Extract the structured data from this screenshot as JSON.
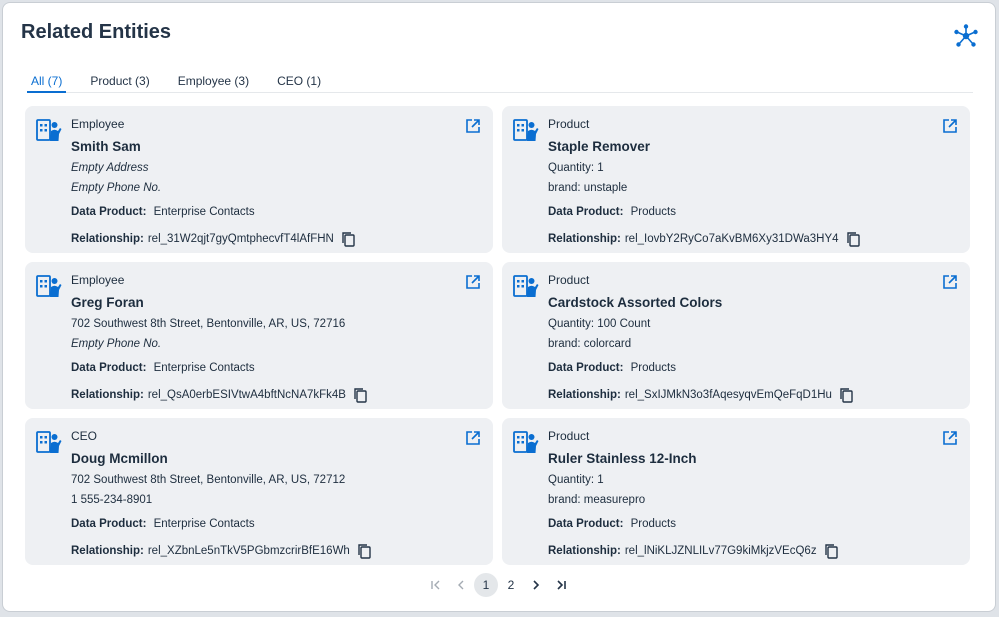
{
  "header": {
    "title": "Related Entities",
    "graph_icon": "network-graph-icon"
  },
  "tabs": [
    {
      "label": "All (7)",
      "active": true
    },
    {
      "label": "Product (3)",
      "active": false
    },
    {
      "label": "Employee (3)",
      "active": false
    },
    {
      "label": "CEO (1)",
      "active": false
    }
  ],
  "labels": {
    "data_product": "Data Product:",
    "relationship": "Relationship:"
  },
  "cards": [
    {
      "type": "Employee",
      "name": "Smith Sam",
      "line1": "Empty Address",
      "line2": "Empty Phone No.",
      "data_product": "Enterprise Contacts",
      "relationship": "rel_31W2qjt7gyQmtphecvfT4lAfFHN"
    },
    {
      "type": "Product",
      "name": "Staple Remover",
      "line1": "Quantity: 1",
      "line2": "brand: unstaple",
      "data_product": "Products",
      "relationship": "rel_IovbY2RyCo7aKvBM6Xy31DWa3HY4"
    },
    {
      "type": "Employee",
      "name": "Greg Foran",
      "line1": "702 Southwest 8th Street, Bentonville, AR, US, 72716",
      "line2": "Empty Phone No.",
      "data_product": "Enterprise Contacts",
      "relationship": "rel_QsA0erbESIVtwA4bftNcNA7kFk4B"
    },
    {
      "type": "Product",
      "name": "Cardstock Assorted Colors",
      "line1": "Quantity: 100 Count",
      "line2": "brand: colorcard",
      "data_product": "Products",
      "relationship": "rel_SxIJMkN3o3fAqesyqvEmQeFqD1Hu"
    },
    {
      "type": "CEO",
      "name": "Doug Mcmillon",
      "line1": "702 Southwest 8th Street, Bentonville, AR, US, 72712",
      "line2": "1 555-234-8901",
      "data_product": "Enterprise Contacts",
      "relationship": "rel_XZbnLe5nTkV5PGbmzcrirBfE16Wh"
    },
    {
      "type": "Product",
      "name": "Ruler Stainless 12-Inch",
      "line1": "Quantity: 1",
      "line2": "brand: measurepro",
      "data_product": "Products",
      "relationship": "rel_lNiKLJZNLILv77G9kiMkjzVEcQ6z"
    }
  ],
  "pagination": {
    "first": "|‹",
    "prev": "‹",
    "pages": [
      "1",
      "2"
    ],
    "current": "1",
    "next": "›",
    "last": "›|"
  },
  "colors": {
    "accent": "#0a6ed1",
    "card_bg": "#eef0f3"
  }
}
